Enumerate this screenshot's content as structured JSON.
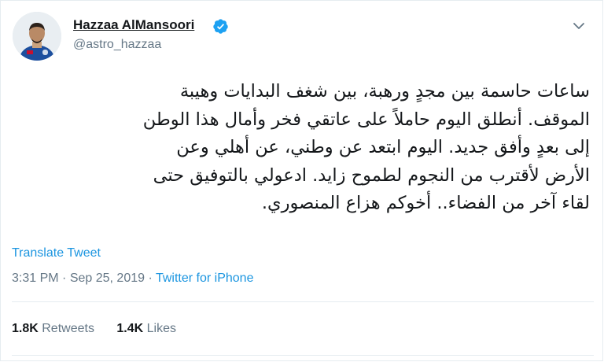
{
  "user": {
    "name": "Hazzaa AlMansoori",
    "handle": "@astro_hazzaa"
  },
  "tweet": {
    "text": "ساعات حاسمة بين مجدٍ ورهبة، بين شغف البدايات وهيبة\nالموقف. أنطلق اليوم حاملاً على عاتقي فخر وأمال هذا الوطن\nإلى بعدٍ وأفق جديد. اليوم ابتعد عن وطني، عن أهلي وعن\nالأرض لأقترب من النجوم  لطموح زايد. ادعولي بالتوفيق حتى\nلقاء آخر من الفضاء.. أخوكم هزاع المنصوري.",
    "translate_label": "Translate Tweet",
    "time": "3:31 PM",
    "separator": "·",
    "date": "Sep 25, 2019",
    "source": "Twitter for iPhone"
  },
  "stats": {
    "retweets_count": "1.8K",
    "retweets_label": "Retweets",
    "likes_count": "1.4K",
    "likes_label": "Likes"
  },
  "colors": {
    "link": "#1b95e0",
    "verified": "#1da1f2",
    "secondary_text": "#657786"
  },
  "icons": {
    "verified": "verified-badge-icon",
    "menu": "chevron-down-icon"
  }
}
